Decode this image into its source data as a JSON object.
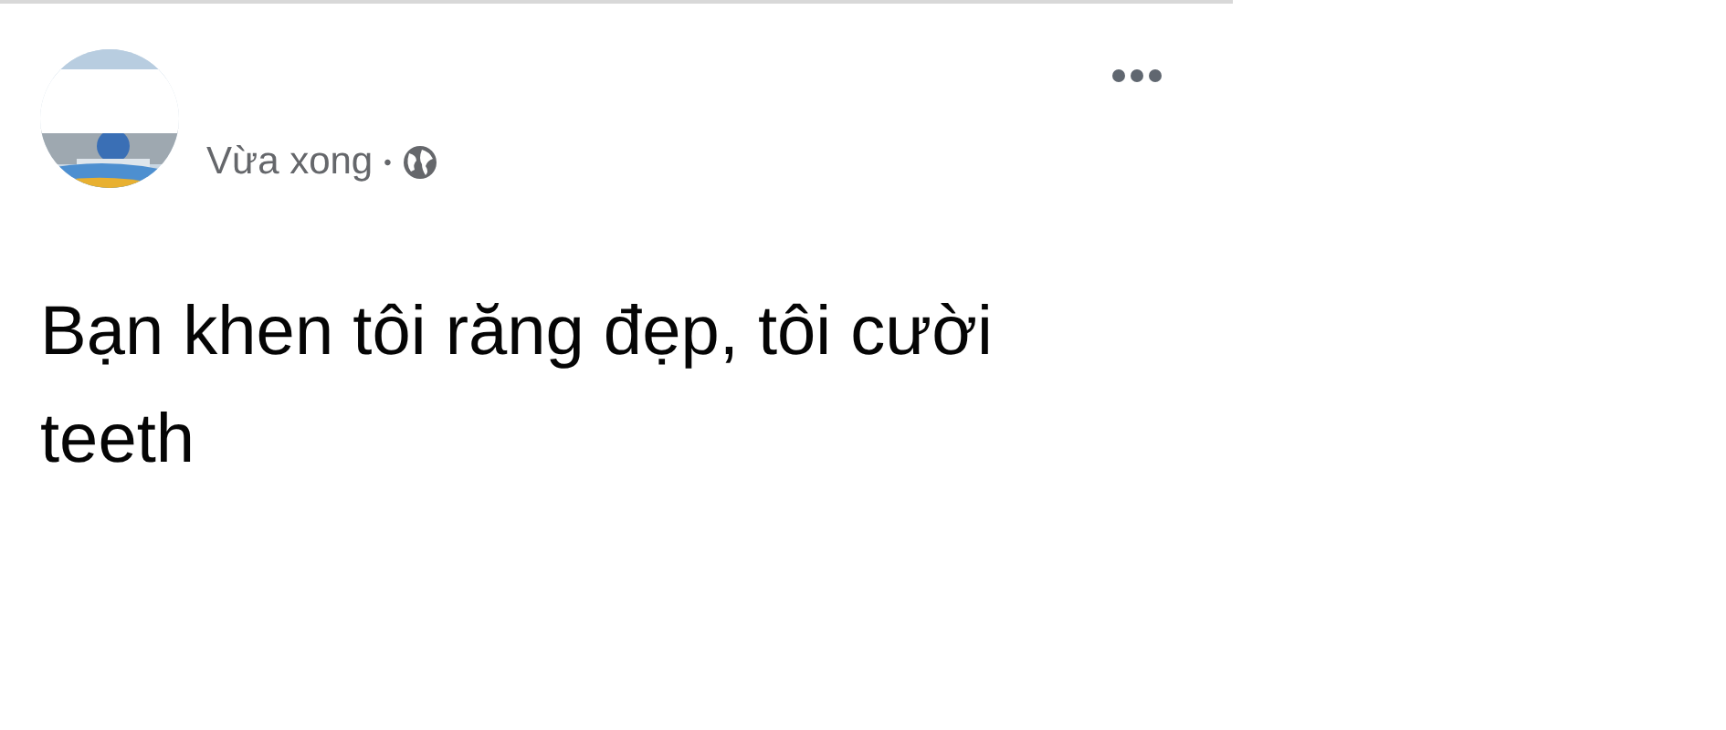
{
  "post": {
    "time": "Vừa xong",
    "separator": "•",
    "text_lines": [
      "Bạn khen tôi răng đẹp, tôi cười",
      "teeth"
    ]
  }
}
